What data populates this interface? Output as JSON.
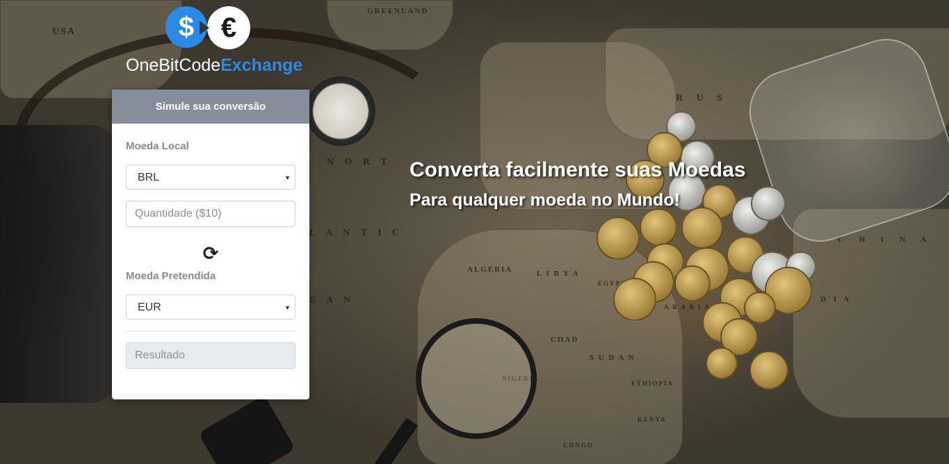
{
  "brand": {
    "name_part1": "OneBitCode",
    "name_part2": "Exchange",
    "dollar_symbol": "$",
    "euro_symbol": "€",
    "accent_color": "#2a8ae6"
  },
  "card": {
    "header": "Simule sua conversão",
    "local_currency_label": "Moeda Local",
    "local_currency_selected": "BRL",
    "amount_placeholder": "Quantidade ($10)",
    "swap_icon": "refresh-icon",
    "target_currency_label": "Moeda Pretendida",
    "target_currency_selected": "EUR",
    "result_placeholder": "Resultado"
  },
  "hero": {
    "title": "Converta facilmente suas Moedas",
    "subtitle": "Para qualquer moeda no Mundo!"
  },
  "map_labels": [
    "USA",
    "GREENLAND",
    "R U S",
    "N O R T",
    "L A N T I C",
    "E A N",
    "ALGERIA",
    "L I B Y A",
    "EGYPT",
    "A R A B I A",
    "CHAD",
    "S U D A N",
    "NIGERIA",
    "ETHIOPIA",
    "KENYA",
    "CONGO",
    "C H I N A",
    "D I A"
  ]
}
